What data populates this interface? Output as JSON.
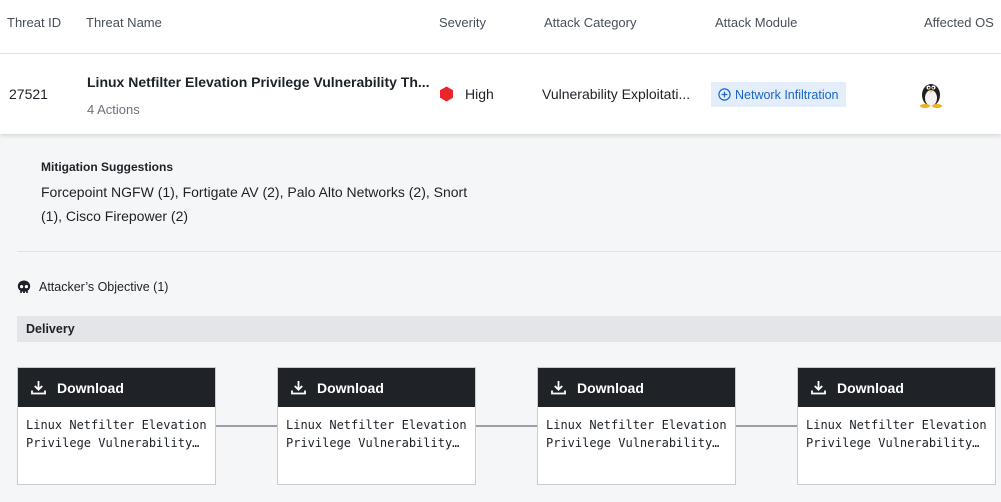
{
  "columns": {
    "threat_id": "Threat ID",
    "threat_name": "Threat Name",
    "severity": "Severity",
    "attack_category": "Attack Category",
    "attack_module": "Attack Module",
    "affected_os": "Affected OS"
  },
  "threat": {
    "id": "27521",
    "name": "Linux Netfilter Elevation Privilege Vulnerability Th...",
    "actions": "4 Actions",
    "severity": "High",
    "severity_color": "#e8262b",
    "attack_category": "Vulnerability Exploitati...",
    "attack_module": "Network Infiltration",
    "os_icon": "linux-tux-icon"
  },
  "mitigation": {
    "title": "Mitigation Suggestions",
    "text": "Forcepoint NGFW (1), Fortigate AV (2), Palo Alto Networks (2), Snort (1), Cisco Firepower (2)"
  },
  "objective": {
    "label": "Attacker’s Objective (1)",
    "icon": "skull-icon"
  },
  "stage": {
    "label": "Delivery"
  },
  "steps": [
    {
      "title": "Download",
      "text": "Linux Netfilter Elevation\nPrivilege Vulnerability…"
    },
    {
      "title": "Download",
      "text": "Linux Netfilter Elevation\nPrivilege Vulnerability…"
    },
    {
      "title": "Download",
      "text": "Linux Netfilter Elevation\nPrivilege Vulnerability…"
    },
    {
      "title": "Download",
      "text": "Linux Netfilter Elevation\nPrivilege Vulnerability…"
    }
  ]
}
